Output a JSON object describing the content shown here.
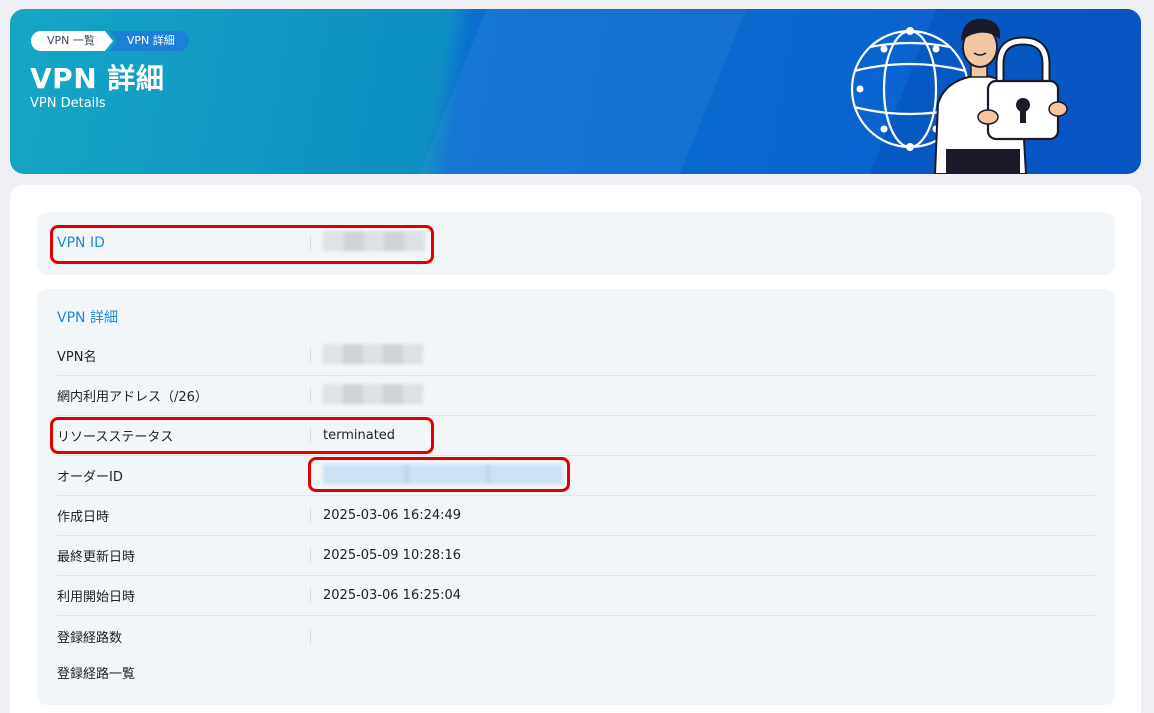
{
  "breadcrumb": {
    "items": [
      {
        "label": "VPN 一覧"
      },
      {
        "label": "VPN 詳細"
      }
    ]
  },
  "header": {
    "title": "VPN 詳細",
    "subtitle": "VPN Details"
  },
  "vpn_id_card": {
    "label": "VPN ID",
    "value": ""
  },
  "details": {
    "section_title": "VPN 詳細",
    "rows": [
      {
        "label": "VPN名",
        "value": ""
      },
      {
        "label": "網内利用アドレス（/26）",
        "value": ""
      },
      {
        "label": "リソースステータス",
        "value": "terminated"
      },
      {
        "label": "オーダーID",
        "value": ""
      },
      {
        "label": "作成日時",
        "value": "2025-03-06 16:24:49"
      },
      {
        "label": "最終更新日時",
        "value": "2025-05-09 10:28:16"
      },
      {
        "label": "利用開始日時",
        "value": "2025-03-06 16:25:04"
      },
      {
        "label": "登録経路数",
        "value": ""
      },
      {
        "label": "登録経路一覧",
        "value": ""
      }
    ]
  },
  "colors": {
    "accent": "#1b8ccf",
    "banner_start": "#16a6c4",
    "banner_end": "#0a5ccf",
    "highlight": "#e00000"
  },
  "icons": {
    "illustration": "person-with-globe-and-padlock-icon"
  }
}
